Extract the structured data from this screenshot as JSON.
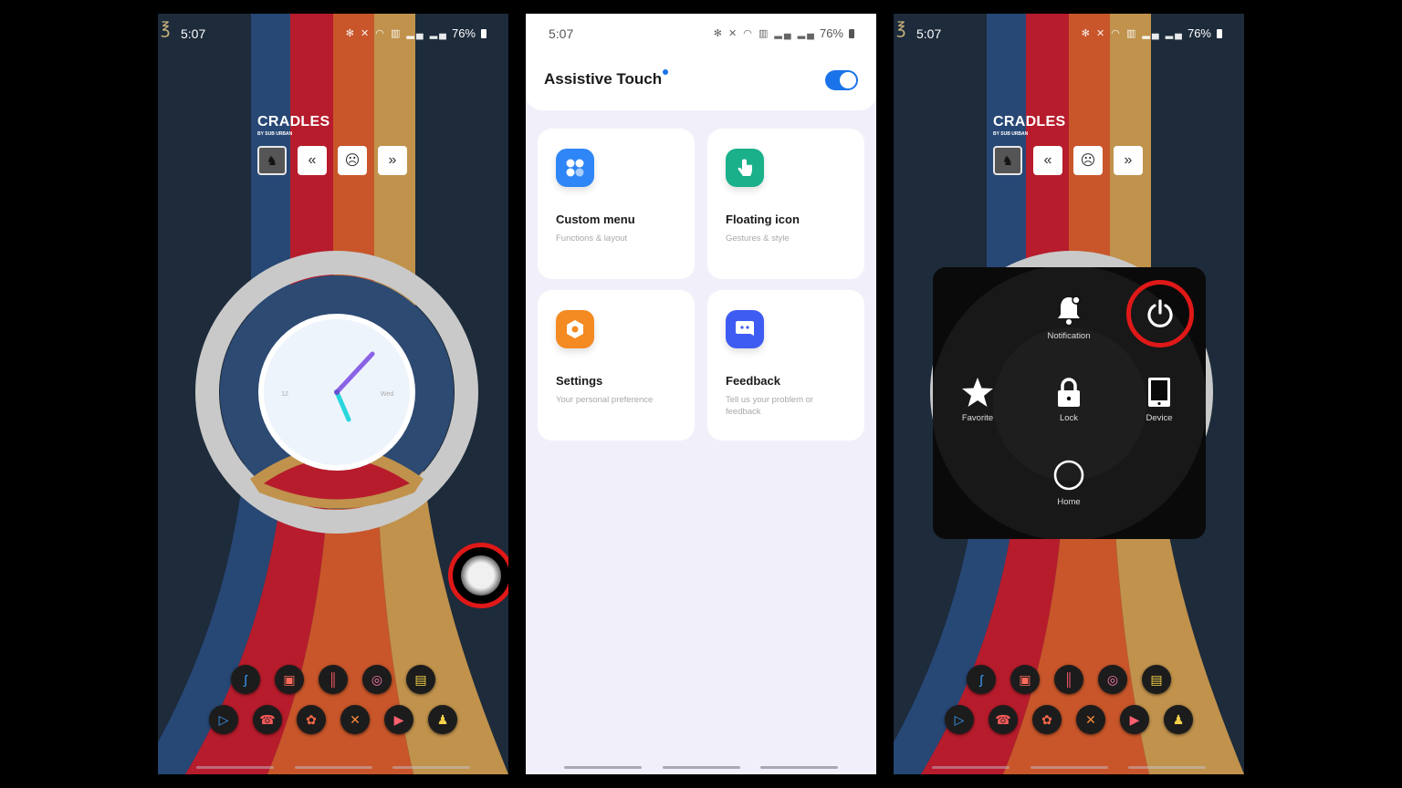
{
  "status_bar": {
    "time": "5:07",
    "battery": "76%",
    "icons": [
      "bluetooth-icon",
      "mute-icon",
      "wifi-icon",
      "volte-icon",
      "signal-icon",
      "signal-icon"
    ]
  },
  "music_widget": {
    "title": "CRADLES",
    "artist": "BY SUB URBAN",
    "controls": {
      "previous": "«",
      "mood": "☹",
      "next": "»"
    }
  },
  "clock_widget": {
    "left_label": "12",
    "right_label": "Wed"
  },
  "dock": {
    "row1": [
      "phantom-app",
      "camera-app",
      "recorder-app",
      "instagram-app",
      "files-app"
    ],
    "row2": [
      "player-app",
      "phone-app",
      "video-app",
      "tools-app",
      "youtube-app",
      "snapchat-app"
    ]
  },
  "assistive_touch": {
    "title": "Assistive Touch",
    "enabled": true,
    "accent_color": "#1a73e8",
    "cards": [
      {
        "title": "Custom menu",
        "subtitle": "Functions & layout",
        "icon": "grid-icon",
        "color": "#2f86f6"
      },
      {
        "title": "Floating icon",
        "subtitle": "Gestures & style",
        "icon": "tap-hand-icon",
        "color": "#19b08a"
      },
      {
        "title": "Settings",
        "subtitle": "Your personal preference",
        "icon": "hex-settings-icon",
        "color": "#f48a22"
      },
      {
        "title": "Feedback",
        "subtitle": "Tell us your problem or feedback",
        "icon": "chat-icon",
        "color": "#3f5cf2"
      }
    ]
  },
  "radial_menu": {
    "items": [
      {
        "label": "Notification",
        "icon": "bell-icon"
      },
      {
        "label": "Favorite",
        "icon": "star-icon"
      },
      {
        "label": "Lock",
        "icon": "lock-icon"
      },
      {
        "label": "Device",
        "icon": "phone-device-icon"
      },
      {
        "label": "Home",
        "icon": "home-circle-icon"
      }
    ],
    "highlighted": "power-icon",
    "highlight_color": "#e01818"
  }
}
